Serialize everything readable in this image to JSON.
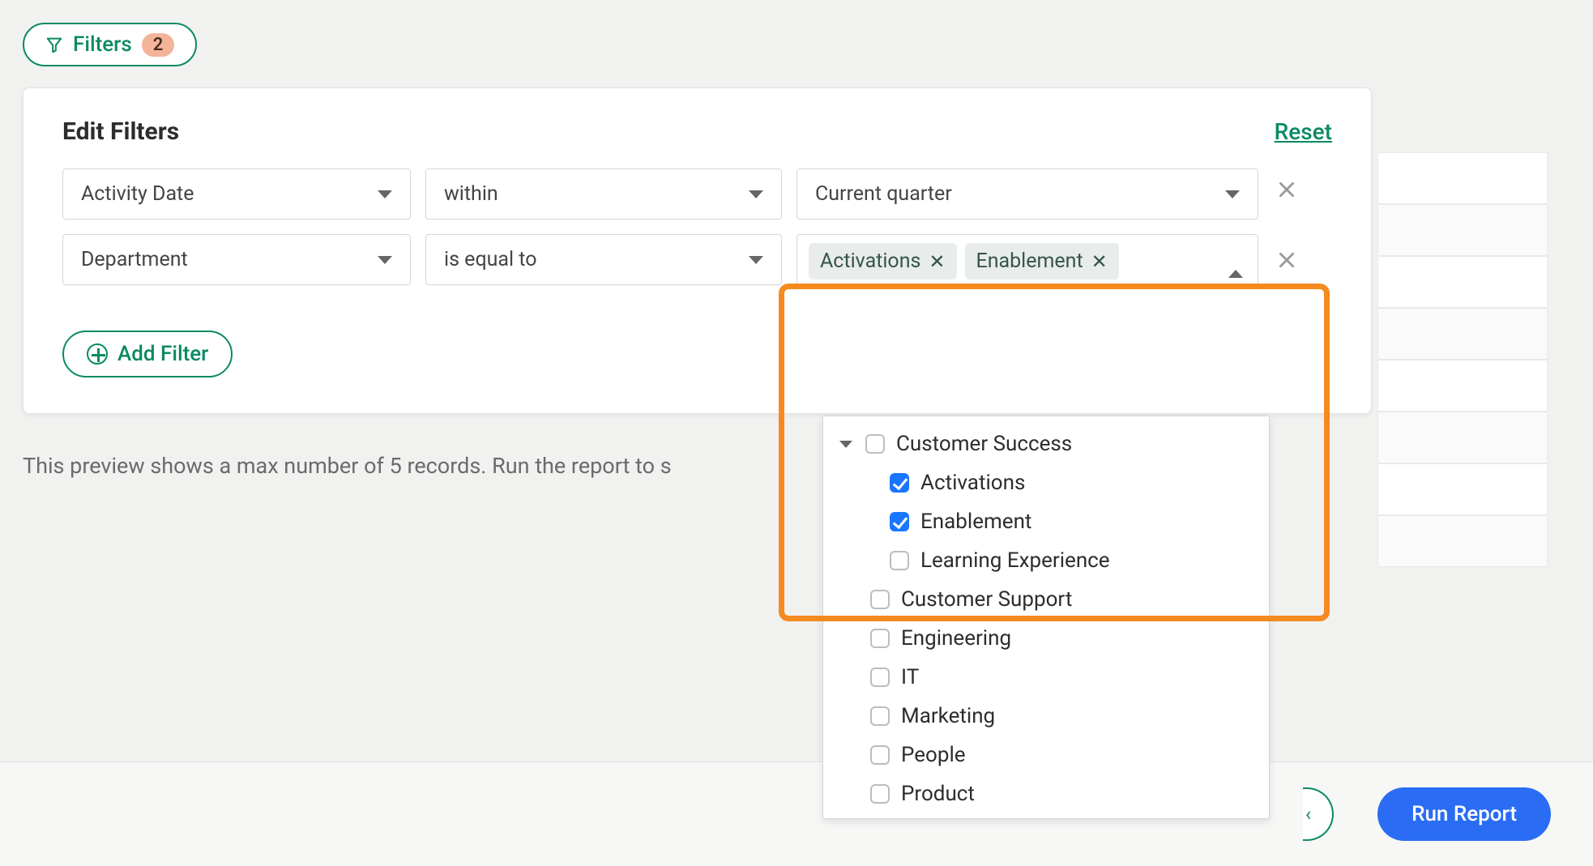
{
  "filters_button": {
    "label": "Filters",
    "count": "2"
  },
  "panel": {
    "title": "Edit Filters",
    "reset_label": "Reset",
    "rows": [
      {
        "field": "Activity Date",
        "operator": "within",
        "value_display": "Current quarter"
      },
      {
        "field": "Department",
        "operator": "is equal to"
      }
    ],
    "selected_chips": [
      {
        "label": "Activations"
      },
      {
        "label": "Enablement"
      }
    ],
    "add_filter_label": "Add Filter"
  },
  "dropdown": {
    "parent": "Customer Success",
    "children": [
      {
        "label": "Activations",
        "checked": true
      },
      {
        "label": "Enablement",
        "checked": true
      },
      {
        "label": "Learning Experience",
        "checked": false
      }
    ],
    "siblings": [
      {
        "label": "Customer Support"
      },
      {
        "label": "Engineering"
      },
      {
        "label": "IT"
      },
      {
        "label": "Marketing"
      },
      {
        "label": "People"
      },
      {
        "label": "Product"
      }
    ]
  },
  "preview_note": "This preview shows a max number of 5 records. Run the report to s",
  "actions": {
    "secondary_fragment": "‹",
    "run_label": "Run Report"
  }
}
